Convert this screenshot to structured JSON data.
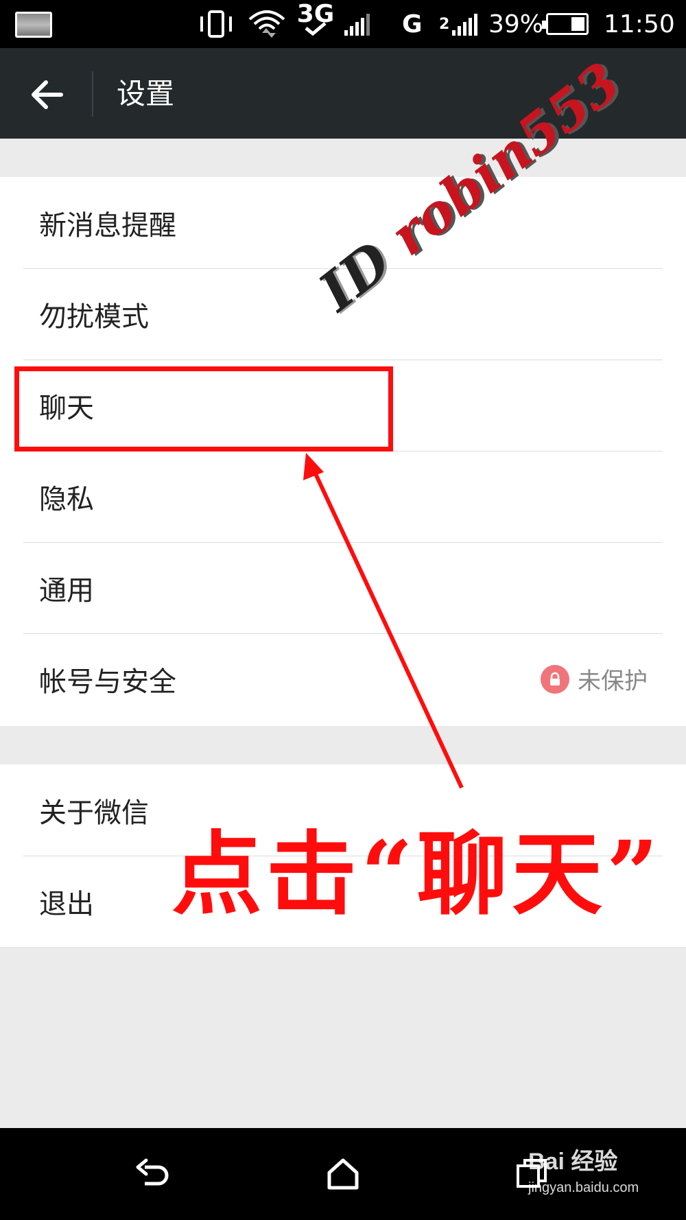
{
  "status_bar": {
    "battery_percent": "39%",
    "battery_level": 0.39,
    "time": "11:50",
    "network_3g": "3G",
    "network_g": "G",
    "sim2_label": "2"
  },
  "app_bar": {
    "title": "设置"
  },
  "settings_group_1": [
    {
      "label": "新消息提醒"
    },
    {
      "label": "勿扰模式"
    },
    {
      "label": "聊天"
    },
    {
      "label": "隐私"
    },
    {
      "label": "通用"
    },
    {
      "label": "帐号与安全",
      "value": "未保护"
    }
  ],
  "settings_group_2": [
    {
      "label": "关于微信"
    },
    {
      "label": "退出"
    }
  ],
  "annotation": {
    "text": "点击“聊天”",
    "color": "#ff0d0d"
  },
  "watermark": {
    "id_prefix": "ID",
    "name": "robin553"
  },
  "baidu_watermark": {
    "logo": "Bai 经验",
    "url": "jingyan.baidu.com"
  },
  "colors": {
    "app_bar": "#24292c",
    "background": "#ebebeb",
    "lock_badge": "#f0757a"
  }
}
